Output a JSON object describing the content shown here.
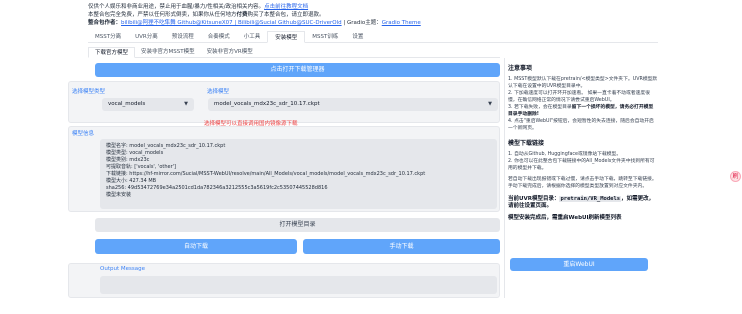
{
  "header": {
    "line1_prefix": "仅供个人娱乐和非商业用途，禁止用于血腥/暴力/性相关/政治相关内容。",
    "line1_link": "点击前往教程文档",
    "line2_prefix": "本整合包完全免费，严禁以任何形式倒卖，如果你从任何地方",
    "line2_bold": "付费",
    "line2_suffix": "购买了本整合包，请立即退款。",
    "line3_prefix": "整合包作者：",
    "line3_authors": "bilibili@阿狸不吃隼舞 Github@KitsuneX07 | Bilibili@Sucial Github@SUC-DriverOld",
    "line3_suffix": " | Gradio主题：",
    "line3_theme": "Gradio Theme"
  },
  "tabs": [
    "MSST分离",
    "UVR分离",
    "预设流程",
    "合奏模式",
    "小工具",
    "安装模型",
    "MSST训练",
    "设置"
  ],
  "subtabs": [
    "下载官方模型",
    "安装非官方MSST模型",
    "安装非官方VR模型"
  ],
  "main": {
    "open_download_manager": "点击打开下载管理器",
    "model_type_label": "选择模型类型",
    "model_type_value": "vocal_models",
    "model_label": "选择模型",
    "model_value": "model_vocals_mdx23c_sdr_10.17.ckpt",
    "warn": "选择模型可以直接调用国内镜像源下载",
    "info_label": "模型信息",
    "info_lines": [
      "模型名字: model_vocals_mdx23c_sdr_10.17.ckpt",
      "模型类型: vocal_models",
      "模型类别: mdx23c",
      "可提取音轨: ['vocals', 'other']",
      "下载链接: https://hf-mirror.com/Sucial/MSST-WebUI/resolve/main/All_Models/vocal_models/model_vocals_mdx23c_sdr_10.17.ckpt",
      "模型大小: 427.34 MB",
      "sha256: 49d53472769e34a2501cd1da782346a3212555c3a5619fc2c53507445528d816",
      "模型未安装"
    ],
    "open_model_dir": "打开模型目录",
    "auto_download": "自动下载",
    "manual_download": "手动下载",
    "output_label": "Output Message",
    "output_value": ""
  },
  "side": {
    "title": "注意事项",
    "notes": [
      "1. MSST模型默认下载在pretrain/<模型类型>文件夹下。UVR模型默认下载在设置中的UVR模型目录中。",
      "2. 下加载速度可以打开环开加速看。 如果一直卡着不动或者速度很慢，在确信网络正常的情况下请尝试重启WebUI。",
      "3. 若下载失败，会在模型目录",
      "留下一个损坏的模型，请务必",
      "打开模型目录手动删除!",
      "4. 点击\"重启WebUI\"按钮后，会短暂性的失去连接，随后会自动开启一个新网页。"
    ],
    "link_title": "模型下载链接",
    "link_notes": [
      "1. 自动从Github, Huggingface或镜像站下载模型。",
      "2. 你也可以在此整合包下载链接中的All_Models文件夹中找到所有可用的模型并下载。"
    ],
    "link_note3": "若自动下载出现报错或下载过慢，请点击手动下载，跳转至下载链接。手动下载完成后，请根据你选择的模型类型放置到对应文件夹内。",
    "uvr_prefix": "当前UVR模型目录：",
    "uvr_code": "pretrain/VR_Models",
    "uvr_suffix": "，如需更改，请前往设置页面。",
    "refresh_note": "模型安装完成后，需重启WebUI刷新模型列表",
    "restart_button": "重启WebUI"
  },
  "float_icon": "刷"
}
